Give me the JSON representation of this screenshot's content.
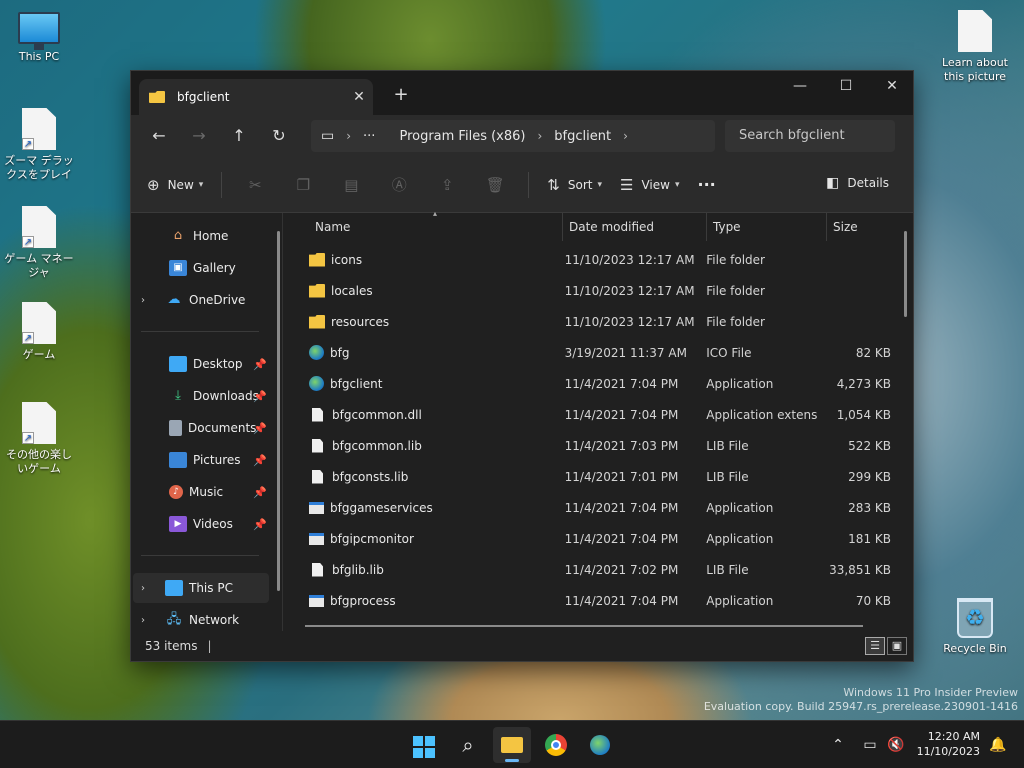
{
  "desktop": {
    "icons": [
      {
        "label": "This PC"
      },
      {
        "label": "ズーマ デラックスをプレイ"
      },
      {
        "label": "ゲーム マネージャ"
      },
      {
        "label": "ゲーム"
      },
      {
        "label": "その他の楽しいゲーム"
      },
      {
        "label": "Learn about this picture"
      },
      {
        "label": "Recycle Bin"
      }
    ],
    "watermark": {
      "line1": "Windows 11 Pro Insider Preview",
      "line2": "Evaluation copy. Build 25947.rs_prerelease.230901-1416"
    }
  },
  "window": {
    "tab_title": "bfgclient",
    "tab_close": "✕",
    "new_tab": "+",
    "controls": {
      "minimize": "—",
      "maximize": "☐",
      "close": "✕"
    },
    "nav": {
      "back": "←",
      "forward": "→",
      "up": "↑",
      "refresh": "↻"
    },
    "breadcrumb": {
      "more": "···",
      "items": [
        "Program Files (x86)",
        "bfgclient"
      ]
    },
    "search_placeholder": "Search bfgclient",
    "commands": {
      "new": "New",
      "sort": "Sort",
      "view": "View",
      "more": "···",
      "details": "Details"
    },
    "sidebar": {
      "items": [
        {
          "label": "Home",
          "icon": "home-icon"
        },
        {
          "label": "Gallery",
          "icon": "gallery-icon"
        },
        {
          "label": "OneDrive",
          "icon": "cloud-icon"
        },
        {
          "label": "Desktop",
          "icon": "desktop-icon"
        },
        {
          "label": "Downloads",
          "icon": "download-icon"
        },
        {
          "label": "Documents",
          "icon": "documents-icon"
        },
        {
          "label": "Pictures",
          "icon": "pictures-icon"
        },
        {
          "label": "Music",
          "icon": "music-icon"
        },
        {
          "label": "Videos",
          "icon": "videos-icon"
        },
        {
          "label": "This PC",
          "icon": "computer-icon"
        },
        {
          "label": "Network",
          "icon": "network-icon"
        }
      ]
    },
    "columns": {
      "name": "Name",
      "date": "Date modified",
      "type": "Type",
      "size": "Size"
    },
    "files": [
      {
        "name": "icons",
        "date": "11/10/2023 12:17 AM",
        "type": "File folder",
        "size": "",
        "icon": "folder"
      },
      {
        "name": "locales",
        "date": "11/10/2023 12:17 AM",
        "type": "File folder",
        "size": "",
        "icon": "folder"
      },
      {
        "name": "resources",
        "date": "11/10/2023 12:17 AM",
        "type": "File folder",
        "size": "",
        "icon": "folder"
      },
      {
        "name": "bfg",
        "date": "3/19/2021 11:37 AM",
        "type": "ICO File",
        "size": "82 KB",
        "icon": "globe"
      },
      {
        "name": "bfgclient",
        "date": "11/4/2021 7:04 PM",
        "type": "Application",
        "size": "4,273 KB",
        "icon": "globe"
      },
      {
        "name": "bfgcommon.dll",
        "date": "11/4/2021 7:04 PM",
        "type": "Application extens...",
        "size": "1,054 KB",
        "icon": "file"
      },
      {
        "name": "bfgcommon.lib",
        "date": "11/4/2021 7:03 PM",
        "type": "LIB File",
        "size": "522 KB",
        "icon": "file"
      },
      {
        "name": "bfgconsts.lib",
        "date": "11/4/2021 7:01 PM",
        "type": "LIB File",
        "size": "299 KB",
        "icon": "file"
      },
      {
        "name": "bfggameservices",
        "date": "11/4/2021 7:04 PM",
        "type": "Application",
        "size": "283 KB",
        "icon": "app"
      },
      {
        "name": "bfgipcmonitor",
        "date": "11/4/2021 7:04 PM",
        "type": "Application",
        "size": "181 KB",
        "icon": "app"
      },
      {
        "name": "bfglib.lib",
        "date": "11/4/2021 7:02 PM",
        "type": "LIB File",
        "size": "33,851 KB",
        "icon": "file"
      },
      {
        "name": "bfgprocess",
        "date": "11/4/2021 7:04 PM",
        "type": "Application",
        "size": "70 KB",
        "icon": "app"
      }
    ],
    "status": {
      "count": "53 items",
      "cursor": "|"
    }
  },
  "taskbar": {
    "apps": [
      "start-icon",
      "search-icon",
      "file-explorer-icon",
      "chrome-icon",
      "game-app-icon"
    ],
    "clock_time": "12:20 AM",
    "clock_date": "11/10/2023",
    "tray_chevron": "⌃"
  },
  "colors": {
    "accent": "#4cc2ff",
    "folder": "#f4c542",
    "window_bg": "#202020"
  }
}
